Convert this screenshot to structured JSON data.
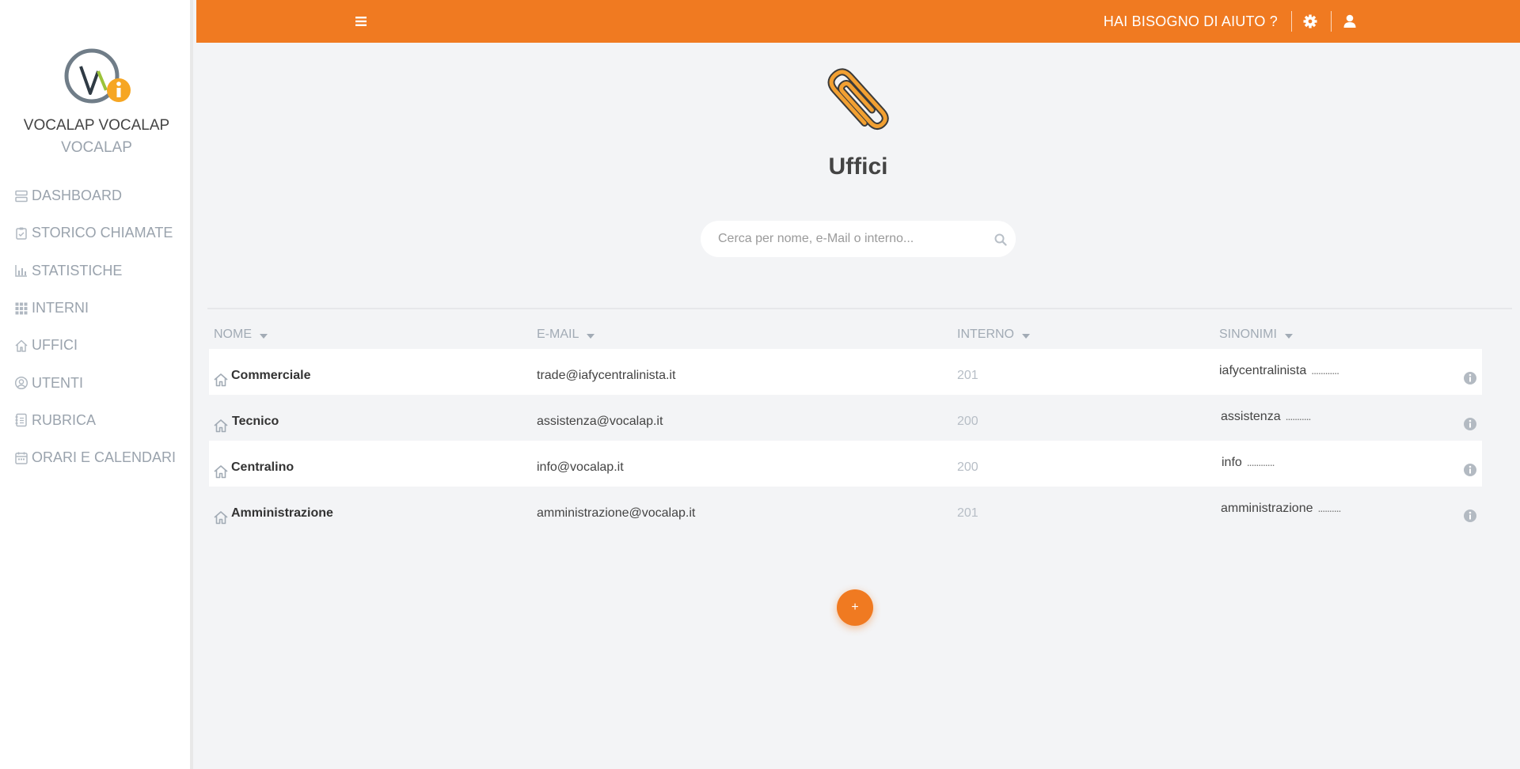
{
  "sidebar": {
    "user_name": "VOCALAP VOCALAP",
    "user_company": "VOCALAP",
    "items": [
      {
        "label": "DASHBOARD",
        "icon": "dashboard-icon"
      },
      {
        "label": "STORICO CHIAMATE",
        "icon": "clipboard-icon"
      },
      {
        "label": "STATISTICHE",
        "icon": "bar-chart-icon"
      },
      {
        "label": "INTERNI",
        "icon": "grid-icon"
      },
      {
        "label": "UFFICI",
        "icon": "home-icon"
      },
      {
        "label": "UTENTI",
        "icon": "user-circle-icon"
      },
      {
        "label": "RUBRICA",
        "icon": "address-book-icon"
      },
      {
        "label": "ORARI E CALENDARI",
        "icon": "calendar-icon"
      }
    ]
  },
  "topbar": {
    "help_label": "HAI BISOGNO DI AIUTO ?",
    "accent_color": "#f07a21"
  },
  "page": {
    "title": "Uffici",
    "search_placeholder": "Cerca per nome, e-Mail o interno..."
  },
  "table": {
    "columns": [
      "NOME",
      "E-MAIL",
      "INTERNO",
      "SINONIMI"
    ],
    "rows": [
      {
        "name": "Commerciale",
        "email": "trade@iafycentralinista.it",
        "interno": "201",
        "sinonimi": "iafycentralinista",
        "dots": "............"
      },
      {
        "name": "Tecnico",
        "email": "assistenza@vocalap.it",
        "interno": "200",
        "sinonimi": "assistenza",
        "dots": "..........."
      },
      {
        "name": "Centralino",
        "email": "info@vocalap.it",
        "interno": "200",
        "sinonimi": "info",
        "dots": "............"
      },
      {
        "name": "Amministrazione",
        "email": "amministrazione@vocalap.it",
        "interno": "201",
        "sinonimi": "amministrazione",
        "dots": ".........."
      }
    ]
  },
  "fab_label": "+"
}
